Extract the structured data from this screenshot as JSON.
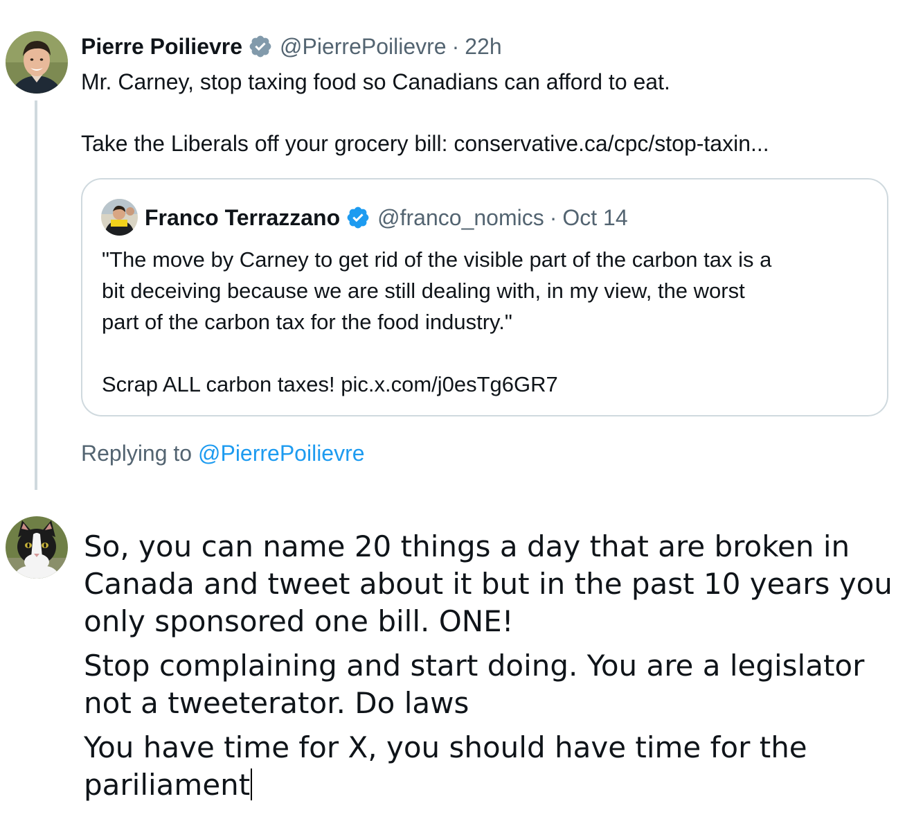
{
  "original_tweet": {
    "author": {
      "name": "Pierre Poilievre",
      "handle": "@PierrePoilievre",
      "verified_badge": "verified-icon",
      "badge_color": "#829aab"
    },
    "separator": "·",
    "time": "22h",
    "body": {
      "line1": "Mr. Carney, stop taxing food so Canadians can afford to eat.",
      "line2": "Take the Liberals off your grocery bill: conservative.ca/cpc/stop-taxin..."
    },
    "quoted_tweet": {
      "author": {
        "name": "Franco Terrazzano",
        "handle": "@franco_nomics",
        "verified_badge": "verified-icon",
        "badge_color": "#1d9bf0"
      },
      "separator": "·",
      "time": "Oct 14",
      "body": {
        "line1": "\"The move by Carney to get rid of the visible part of the carbon tax is a",
        "line2": "bit deceiving because we are still dealing with, in my view, the worst",
        "line3": "part of the carbon tax for the food industry.\"",
        "line4": "Scrap ALL carbon taxes! pic.x.com/j0esTg6GR7"
      }
    }
  },
  "replying_to": {
    "prefix": "Replying to",
    "mention": "@PierrePoilievre"
  },
  "reply_draft": {
    "paragraph1": {
      "line1": "So, you can name 20 things a day that are broken in",
      "line2": "Canada and tweet about it but in the past 10 years you",
      "line3": "only sponsored one bill. ONE!"
    },
    "paragraph2": {
      "line1": "Stop complaining and start doing. You are a legislator",
      "line2": "not a tweeterator. Do laws"
    },
    "paragraph3": {
      "line1": "You have time for X, you should have time for the",
      "line2": "pariliament"
    }
  },
  "colors": {
    "text_primary": "#0f1419",
    "text_secondary": "#536471",
    "link": "#1d9bf0",
    "border": "#cfd9de"
  }
}
